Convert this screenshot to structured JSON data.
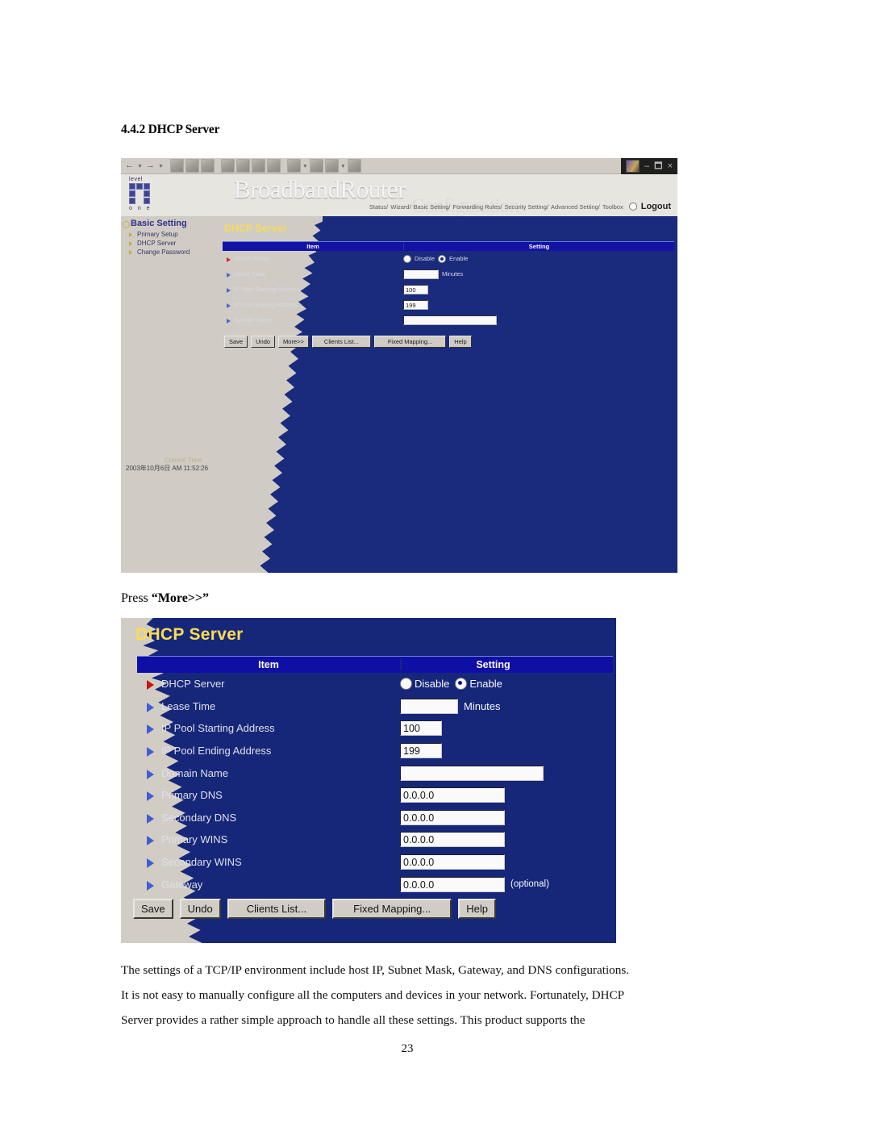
{
  "document": {
    "section_heading": "4.4.2 DHCP Server",
    "press_more_prefix": "Press ",
    "press_more_quoted": "“More>>”",
    "paragraph_1": "The settings of a TCP/IP environment include host IP, Subnet Mask, Gateway, and DNS configurations.",
    "paragraph_2": "It is not easy to manually configure all the computers and devices in your network. Fortunately, DHCP",
    "paragraph_3": "Server provides a rather simple approach to handle all these settings. This product supports the",
    "page_number": "23"
  },
  "browser": {
    "window_controls": {
      "minimize": "–",
      "restore": "⬚",
      "close": "×"
    },
    "toolbar_icons": [
      "back-arrow-icon",
      "forward-arrow-icon",
      "stop-icon",
      "refresh-icon",
      "home-icon",
      "search-icon",
      "favorites-icon",
      "history-icon",
      "channels-icon",
      "mail-icon",
      "print-icon",
      "edit-icon",
      "discuss-icon"
    ],
    "brand": {
      "logo_top": "level",
      "logo_bottom": "o n e",
      "title": "BroadbandRouter",
      "subtitle": "Configuration"
    },
    "nav": {
      "items": [
        "Status/",
        "Wizard/",
        "Basic Setting/",
        "Forwarding Rules/",
        "Security Setting/",
        "Advanced Setting/",
        "Toolbox"
      ],
      "logout": "Logout"
    },
    "sidebar": {
      "heading": "Basic Setting",
      "items": [
        {
          "label": "Primary Setup"
        },
        {
          "label": "DHCP Server"
        },
        {
          "label": "Change Password"
        }
      ]
    },
    "current_time": {
      "label": "Current Time",
      "value": "2003年10月6日 AM 11:52:26"
    }
  },
  "dhcp_panel_small": {
    "title": "DHCP Server",
    "columns": {
      "item": "Item",
      "setting": "Setting"
    },
    "rows": [
      {
        "label": "DHCP Server",
        "type": "radio",
        "options": [
          "Disable",
          "Enable"
        ],
        "selected": "Enable",
        "marker": "red"
      },
      {
        "label": "Lease Time",
        "type": "text",
        "value": "",
        "unit": "Minutes",
        "marker": "blue"
      },
      {
        "label": "IP Pool Starting Address",
        "type": "text",
        "value": "100",
        "unit": "",
        "marker": "blue"
      },
      {
        "label": "IP Pool Ending Address",
        "type": "text",
        "value": "199",
        "unit": "",
        "marker": "blue"
      },
      {
        "label": "Domain Name",
        "type": "text",
        "value": "",
        "unit": "",
        "marker": "blue"
      }
    ],
    "buttons": [
      "Save",
      "Undo",
      "More>>",
      "Clients List...",
      "Fixed Mapping...",
      "Help"
    ]
  },
  "dhcp_panel_large": {
    "title": "DHCP Server",
    "columns": {
      "item": "Item",
      "setting": "Setting"
    },
    "rows": [
      {
        "label": "DHCP Server",
        "type": "radio",
        "options": [
          "Disable",
          "Enable"
        ],
        "selected": "Enable",
        "marker": "red"
      },
      {
        "label": "Lease Time",
        "type": "text",
        "value": "",
        "unit": "Minutes",
        "marker": "blue"
      },
      {
        "label": "IP Pool Starting Address",
        "type": "text",
        "value": "100",
        "unit": "",
        "marker": "blue"
      },
      {
        "label": "IP Pool Ending Address",
        "type": "text",
        "value": "199",
        "unit": "",
        "marker": "blue"
      },
      {
        "label": "Domain Name",
        "type": "text",
        "value": "",
        "unit": "",
        "marker": "blue"
      },
      {
        "label": "Primary DNS",
        "type": "text",
        "value": "0.0.0.0",
        "unit": "",
        "marker": "blue"
      },
      {
        "label": "Secondary DNS",
        "type": "text",
        "value": "0.0.0.0",
        "unit": "",
        "marker": "blue"
      },
      {
        "label": "Primary WINS",
        "type": "text",
        "value": "0.0.0.0",
        "unit": "",
        "marker": "blue"
      },
      {
        "label": "Secondary WINS",
        "type": "text",
        "value": "0.0.0.0",
        "unit": "",
        "marker": "blue"
      },
      {
        "label": "Gateway",
        "type": "text",
        "value": "0.0.0.0",
        "unit": "(optional)",
        "marker": "blue"
      }
    ],
    "buttons": [
      "Save",
      "Undo",
      "Clients List...",
      "Fixed Mapping...",
      "Help"
    ]
  },
  "colors": {
    "panel_blue": "#12237a",
    "header_blue": "#0a0aa8",
    "title_yellow": "#ffe14d",
    "marker_red": "#cc1111",
    "marker_blue": "#3d5cd8",
    "chrome_grey": "#d4d0c8"
  }
}
